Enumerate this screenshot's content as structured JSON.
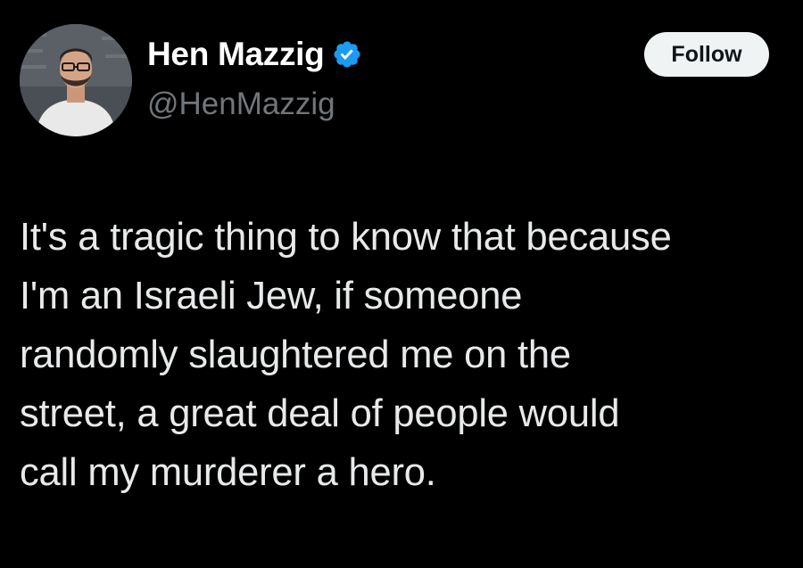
{
  "author": {
    "display_name": "Hen Mazzig",
    "handle": "@HenMazzig",
    "verified_icon": "verified-badge-icon",
    "avatar": "profile-photo"
  },
  "follow_button": {
    "label": "Follow"
  },
  "tweet": {
    "lines": [
      "It's a tragic thing to know that because",
      "I'm an Israeli Jew, if someone",
      "randomly slaughtered me on the",
      "street, a great deal of people would",
      "call my murderer a hero."
    ]
  },
  "colors": {
    "background": "#000000",
    "text_primary": "#e7e9ea",
    "text_secondary": "#71767b",
    "verified_blue": "#1d9bf0",
    "follow_bg": "#eff3f4",
    "follow_text": "#0f1419"
  }
}
